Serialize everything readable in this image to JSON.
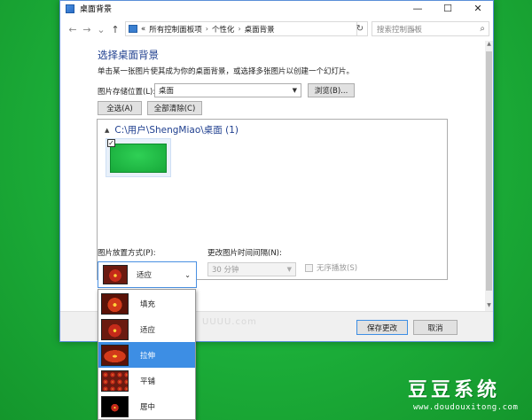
{
  "window": {
    "title": "桌面背景",
    "controls": {
      "minimize": "—",
      "maximize": "☐",
      "close": "✕"
    }
  },
  "addressbar": {
    "back": "←",
    "forward": "→",
    "history": "⌄",
    "up": "↑",
    "breadcrumb_prefix": "«",
    "crumbs": [
      "所有控制面板项",
      "个性化",
      "桌面背景"
    ],
    "crumb_separator": "›",
    "dropdown": "⌄",
    "refresh": "↻",
    "search_placeholder": "搜索控制面板",
    "search_icon": "⌕"
  },
  "main": {
    "heading": "选择桌面背景",
    "description": "单击某一张图片使其成为你的桌面背景，或选择多张图片以创建一个幻灯片。",
    "location_label": "图片存储位置(L):",
    "location_value": "桌面",
    "browse_button": "浏览(B)...",
    "select_all_button": "全选(A)",
    "clear_all_button": "全部清除(C)",
    "gallery": {
      "group_toggle": "▲",
      "group_title": "C:\\用户\\ShengMiao\\桌面 (1)",
      "checkmark": "✓"
    },
    "position_label": "图片放置方式(P):",
    "position_value": "适应",
    "interval_label": "更改图片时间间隔(N):",
    "interval_value": "30 分钟",
    "shuffle_label": "无序播放(S)"
  },
  "footer": {
    "faint_text": "UUUU.com",
    "save_button": "保存更改",
    "cancel_button": "取消"
  },
  "position_options": [
    {
      "label": "填充",
      "thumb": "fill",
      "selected": false
    },
    {
      "label": "适应",
      "thumb": "fit",
      "selected": false
    },
    {
      "label": "拉伸",
      "thumb": "stretch",
      "selected": true
    },
    {
      "label": "平铺",
      "thumb": "tile",
      "selected": false
    },
    {
      "label": "居中",
      "thumb": "center",
      "selected": false
    }
  ],
  "watermark": {
    "brand": "豆豆系统",
    "url": "www.doudouxitong.com"
  },
  "icons": {
    "window_icon": "control-panel-icon",
    "address_icon": "control-panel-icon"
  },
  "colors": {
    "desktop_green": "#1bb93a",
    "link_blue": "#1f3f8f",
    "selection_blue": "#3d8ee4"
  }
}
